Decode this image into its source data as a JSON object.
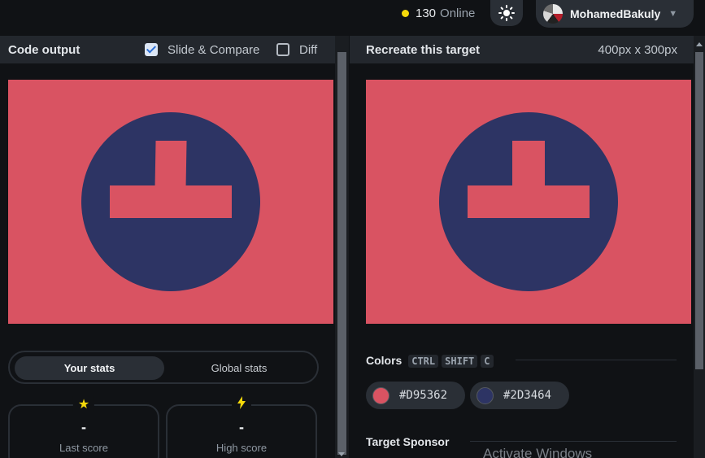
{
  "topbar": {
    "online_count": "130",
    "online_label": "Online",
    "username": "MohamedBakuly"
  },
  "left_panel": {
    "title": "Code output",
    "slide_compare_label": "Slide & Compare",
    "slide_compare_checked": true,
    "diff_label": "Diff",
    "diff_checked": false
  },
  "right_panel": {
    "title": "Recreate this target",
    "dimensions": "400px x 300px"
  },
  "stats": {
    "tab_your": "Your stats",
    "tab_global": "Global stats",
    "active_tab": "Your stats",
    "last_score_value": "-",
    "last_score_label": "Last score",
    "high_score_value": "-",
    "high_score_label": "High score"
  },
  "colors_section": {
    "title": "Colors",
    "shortcut_keys": [
      "CTRL",
      "SHIFT",
      "C"
    ],
    "swatches": [
      {
        "hex": "#D95362",
        "color": "#d95362"
      },
      {
        "hex": "#2D3464",
        "color": "#2d3464"
      }
    ]
  },
  "sponsor": {
    "title": "Target Sponsor"
  },
  "watermark": "Activate Windows",
  "icons": {
    "theme": "sun-icon",
    "caret": "chevron-down-icon",
    "last_score": "star-icon",
    "high_score": "lightning-icon"
  },
  "accent_colors": {
    "online_dot": "#f5d90a",
    "canvas_bg": "#d95362",
    "shape": "#2d3464"
  }
}
